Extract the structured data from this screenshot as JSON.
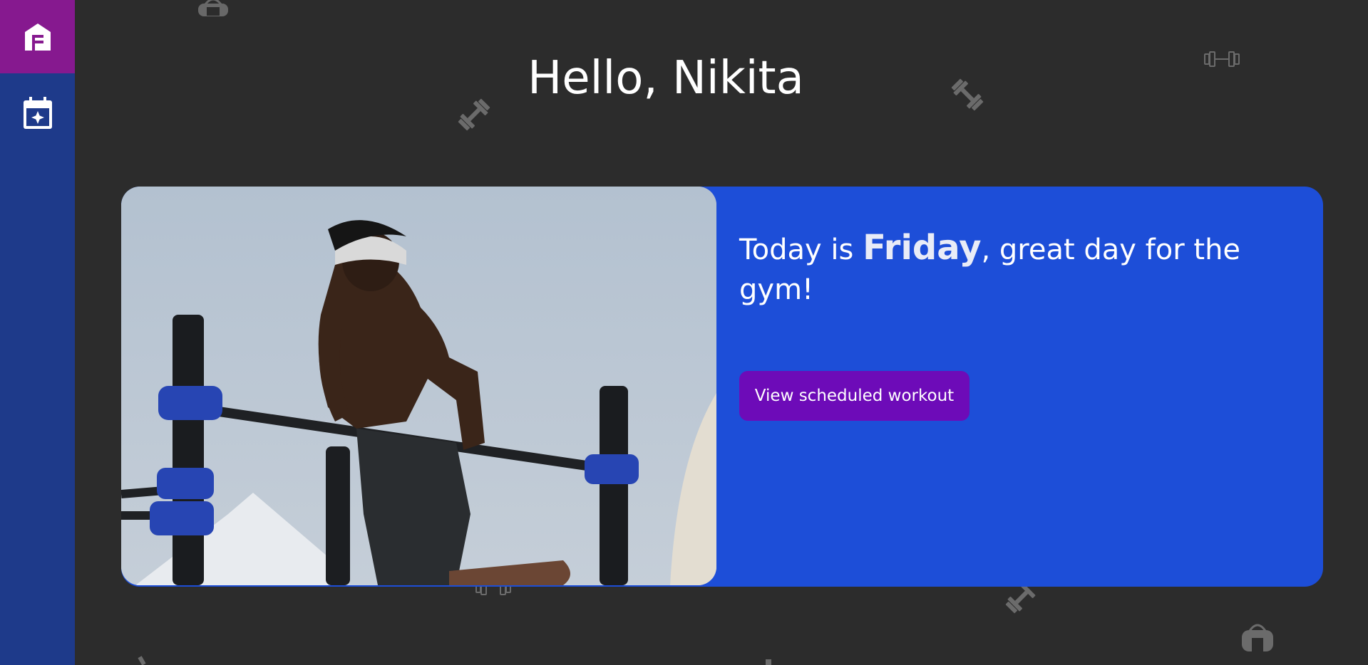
{
  "nav": {
    "items": [
      {
        "name": "home",
        "icon": "home-icon",
        "active": true
      },
      {
        "name": "schedule",
        "icon": "calendar-star-icon",
        "active": false
      }
    ]
  },
  "greeting": {
    "title": "Hello, Nikita"
  },
  "hero": {
    "text_prefix": "Today is ",
    "day": "Friday",
    "text_suffix": ", great day for the gym!",
    "image": "athlete-doing-dips-on-bars-photo",
    "button_label": "View scheduled workout"
  },
  "background_icons": [
    "gym-bag-icon",
    "dumbbell-icon"
  ],
  "colors": {
    "background": "#2c2c2c",
    "sidebar": "#1e3a8a",
    "active_nav": "#86198f",
    "card": "#1d4ed8",
    "button": "#6d0bb8"
  }
}
